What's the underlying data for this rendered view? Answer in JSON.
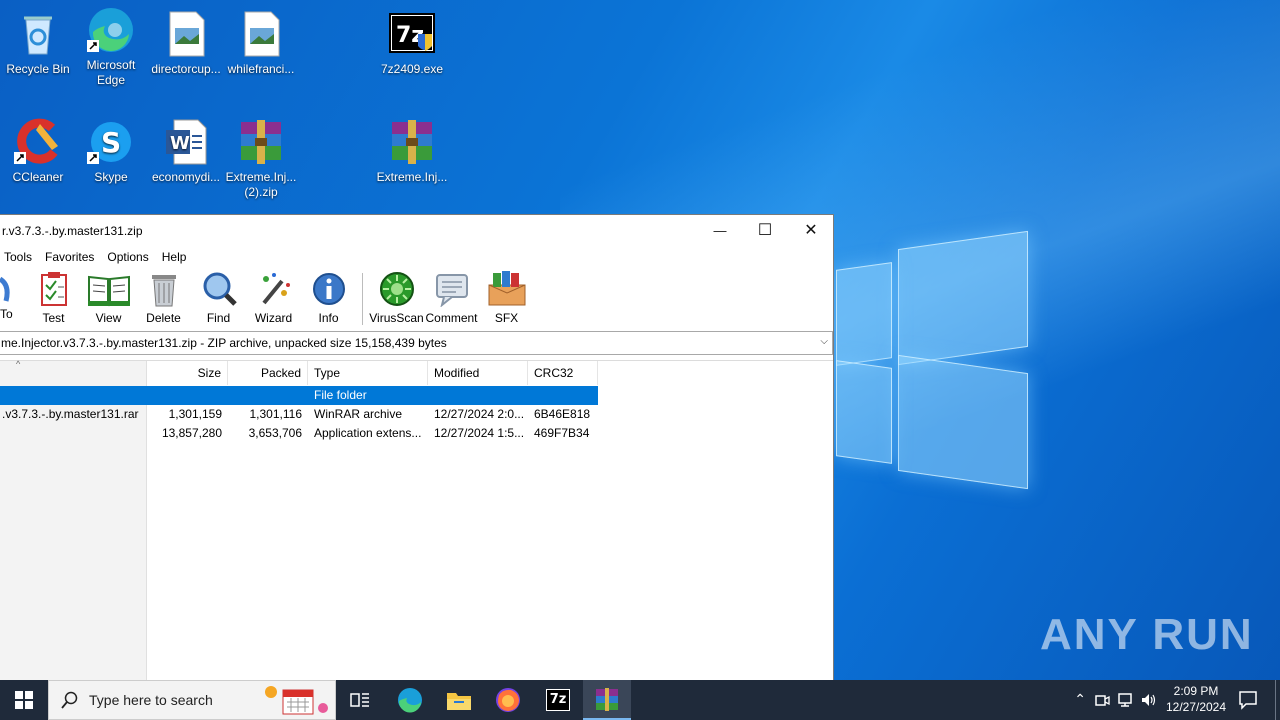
{
  "desktop": {
    "icons": [
      {
        "label": "Recycle Bin"
      },
      {
        "label": "Microsoft Edge"
      },
      {
        "label": "directorcup..."
      },
      {
        "label": "whilefranci..."
      },
      {
        "label": "7z2409.exe"
      },
      {
        "label": "CCleaner"
      },
      {
        "label": "Skype"
      },
      {
        "label": "economydi..."
      },
      {
        "label": "Extreme.Inj... (2).zip"
      },
      {
        "label": "Extreme.Inj..."
      }
    ],
    "watermark": "ANY RUN"
  },
  "window": {
    "title": "r.v3.7.3.-.by.master131.zip",
    "controls": {
      "minimize": "—",
      "maximize": "☐",
      "close": "✕"
    },
    "menu": [
      "Tools",
      "Favorites",
      "Options",
      "Help"
    ],
    "toolbar": [
      "To",
      "Test",
      "View",
      "Delete",
      "Find",
      "Wizard",
      "Info",
      "VirusScan",
      "Comment",
      "SFX"
    ],
    "address": "me.Injector.v3.7.3.-.by.master131.zip - ZIP archive, unpacked size 15,158,439 bytes",
    "columns": [
      "Size",
      "Packed",
      "Type",
      "Modified",
      "CRC32"
    ],
    "rows": [
      {
        "name": "",
        "size": "",
        "packed": "",
        "type": "File folder",
        "modified": "",
        "crc": ""
      },
      {
        "name": ".v3.7.3.-.by.master131.rar",
        "size": "1,301,159",
        "packed": "1,301,116",
        "type": "WinRAR archive",
        "modified": "12/27/2024 2:0...",
        "crc": "6B46E818"
      },
      {
        "name": "",
        "size": "13,857,280",
        "packed": "3,653,706",
        "type": "Application extens...",
        "modified": "12/27/2024 1:5...",
        "crc": "469F7B34"
      }
    ]
  },
  "taskbar": {
    "search_placeholder": "Type here to search",
    "time": "2:09 PM",
    "date": "12/27/2024",
    "app_7z": "7z"
  },
  "colors": {
    "selection": "#0078d7",
    "taskbar": "#1f2a3a"
  }
}
